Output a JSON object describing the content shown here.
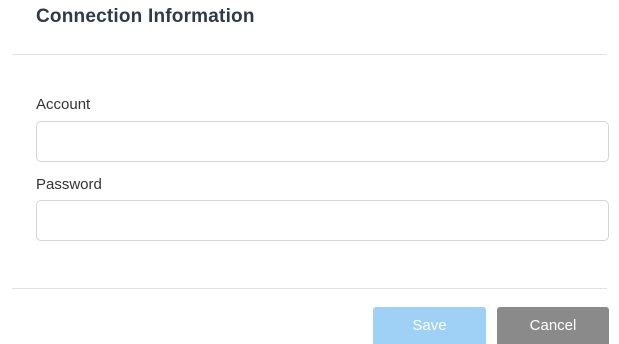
{
  "dialog": {
    "title": "Connection Information"
  },
  "form": {
    "account": {
      "label": "Account",
      "value": "",
      "placeholder": ""
    },
    "password": {
      "label": "Password",
      "value": "",
      "placeholder": ""
    }
  },
  "footer": {
    "save_label": "Save",
    "cancel_label": "Cancel"
  },
  "colors": {
    "save_button": "#9fd0f5",
    "cancel_button": "#8a8a8a",
    "title_text": "#2e3a46",
    "divider": "#e2e2e2"
  }
}
